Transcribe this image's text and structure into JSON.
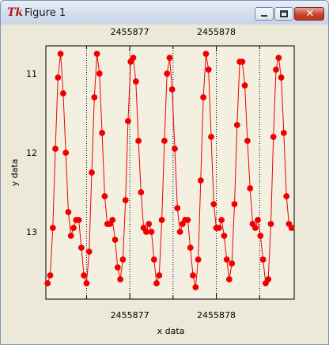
{
  "window": {
    "title": "Figure 1",
    "app_icon_glyph": "Tk",
    "icons": [
      "tk-app-icon",
      "minimize-icon",
      "maximize-icon",
      "close-icon"
    ]
  },
  "chart_data": {
    "type": "line",
    "title": "",
    "xlabel": "x data",
    "ylabel": "y data",
    "xlim": [
      2455876.03,
      2455878.9
    ],
    "ylim": [
      13.85,
      10.65
    ],
    "y_inverted": true,
    "x_ticks": [
      "2455877",
      "2455878"
    ],
    "x_tick_values": [
      2455877,
      2455878
    ],
    "y_ticks": [
      "11",
      "12",
      "13"
    ],
    "y_tick_values": [
      11,
      12,
      13
    ],
    "grid": true,
    "colors": {
      "series": "#ee0000",
      "grid": "#000000"
    },
    "series": [
      {
        "marker": "circle",
        "x": [
          2455876.05,
          2455876.08,
          2455876.11,
          2455876.14,
          2455876.17,
          2455876.2,
          2455876.23,
          2455876.26,
          2455876.29,
          2455876.32,
          2455876.35,
          2455876.38,
          2455876.41,
          2455876.44,
          2455876.47,
          2455876.5,
          2455876.53,
          2455876.56,
          2455876.59,
          2455876.62,
          2455876.65,
          2455876.68,
          2455876.71,
          2455876.74,
          2455876.77,
          2455876.8,
          2455876.83,
          2455876.86,
          2455876.89,
          2455876.92,
          2455876.95,
          2455876.98,
          2455877.01,
          2455877.04,
          2455877.07,
          2455877.1,
          2455877.13,
          2455877.16,
          2455877.19,
          2455877.22,
          2455877.25,
          2455877.28,
          2455877.31,
          2455877.34,
          2455877.37,
          2455877.4,
          2455877.43,
          2455877.46,
          2455877.49,
          2455877.52,
          2455877.55,
          2455877.58,
          2455877.61,
          2455877.64,
          2455877.67,
          2455877.7,
          2455877.73,
          2455877.76,
          2455877.79,
          2455877.82,
          2455877.85,
          2455877.88,
          2455877.91,
          2455877.94,
          2455877.97,
          2455878.0,
          2455878.03,
          2455878.06,
          2455878.09,
          2455878.12,
          2455878.15,
          2455878.18,
          2455878.21,
          2455878.24,
          2455878.27,
          2455878.3,
          2455878.33,
          2455878.36,
          2455878.39,
          2455878.42,
          2455878.45,
          2455878.48,
          2455878.51,
          2455878.54,
          2455878.57,
          2455878.6,
          2455878.63,
          2455878.66,
          2455878.69,
          2455878.72,
          2455878.75,
          2455878.78,
          2455878.81,
          2455878.84,
          2455878.87
        ],
        "y": [
          13.65,
          13.55,
          12.95,
          11.95,
          11.05,
          10.75,
          11.25,
          12.0,
          12.75,
          13.05,
          12.95,
          12.85,
          12.85,
          13.2,
          13.55,
          13.65,
          13.25,
          12.25,
          11.3,
          10.75,
          11.0,
          11.75,
          12.55,
          12.9,
          12.9,
          12.85,
          13.1,
          13.45,
          13.6,
          13.35,
          12.6,
          11.6,
          10.85,
          10.8,
          11.1,
          11.85,
          12.5,
          12.95,
          13.0,
          12.9,
          13.0,
          13.35,
          13.65,
          13.55,
          12.85,
          11.85,
          11.0,
          10.8,
          11.2,
          11.95,
          12.7,
          13.0,
          12.9,
          12.85,
          12.85,
          13.2,
          13.55,
          13.7,
          13.35,
          12.35,
          11.3,
          10.75,
          10.95,
          11.8,
          12.65,
          12.95,
          12.95,
          12.85,
          13.05,
          13.35,
          13.6,
          13.4,
          12.65,
          11.65,
          10.85,
          10.85,
          11.15,
          11.85,
          12.45,
          12.9,
          12.95,
          12.85,
          13.05,
          13.35,
          13.65,
          13.6,
          12.9,
          11.8,
          10.95,
          10.8,
          11.05,
          11.75,
          12.55,
          12.9,
          12.95
        ]
      }
    ]
  }
}
